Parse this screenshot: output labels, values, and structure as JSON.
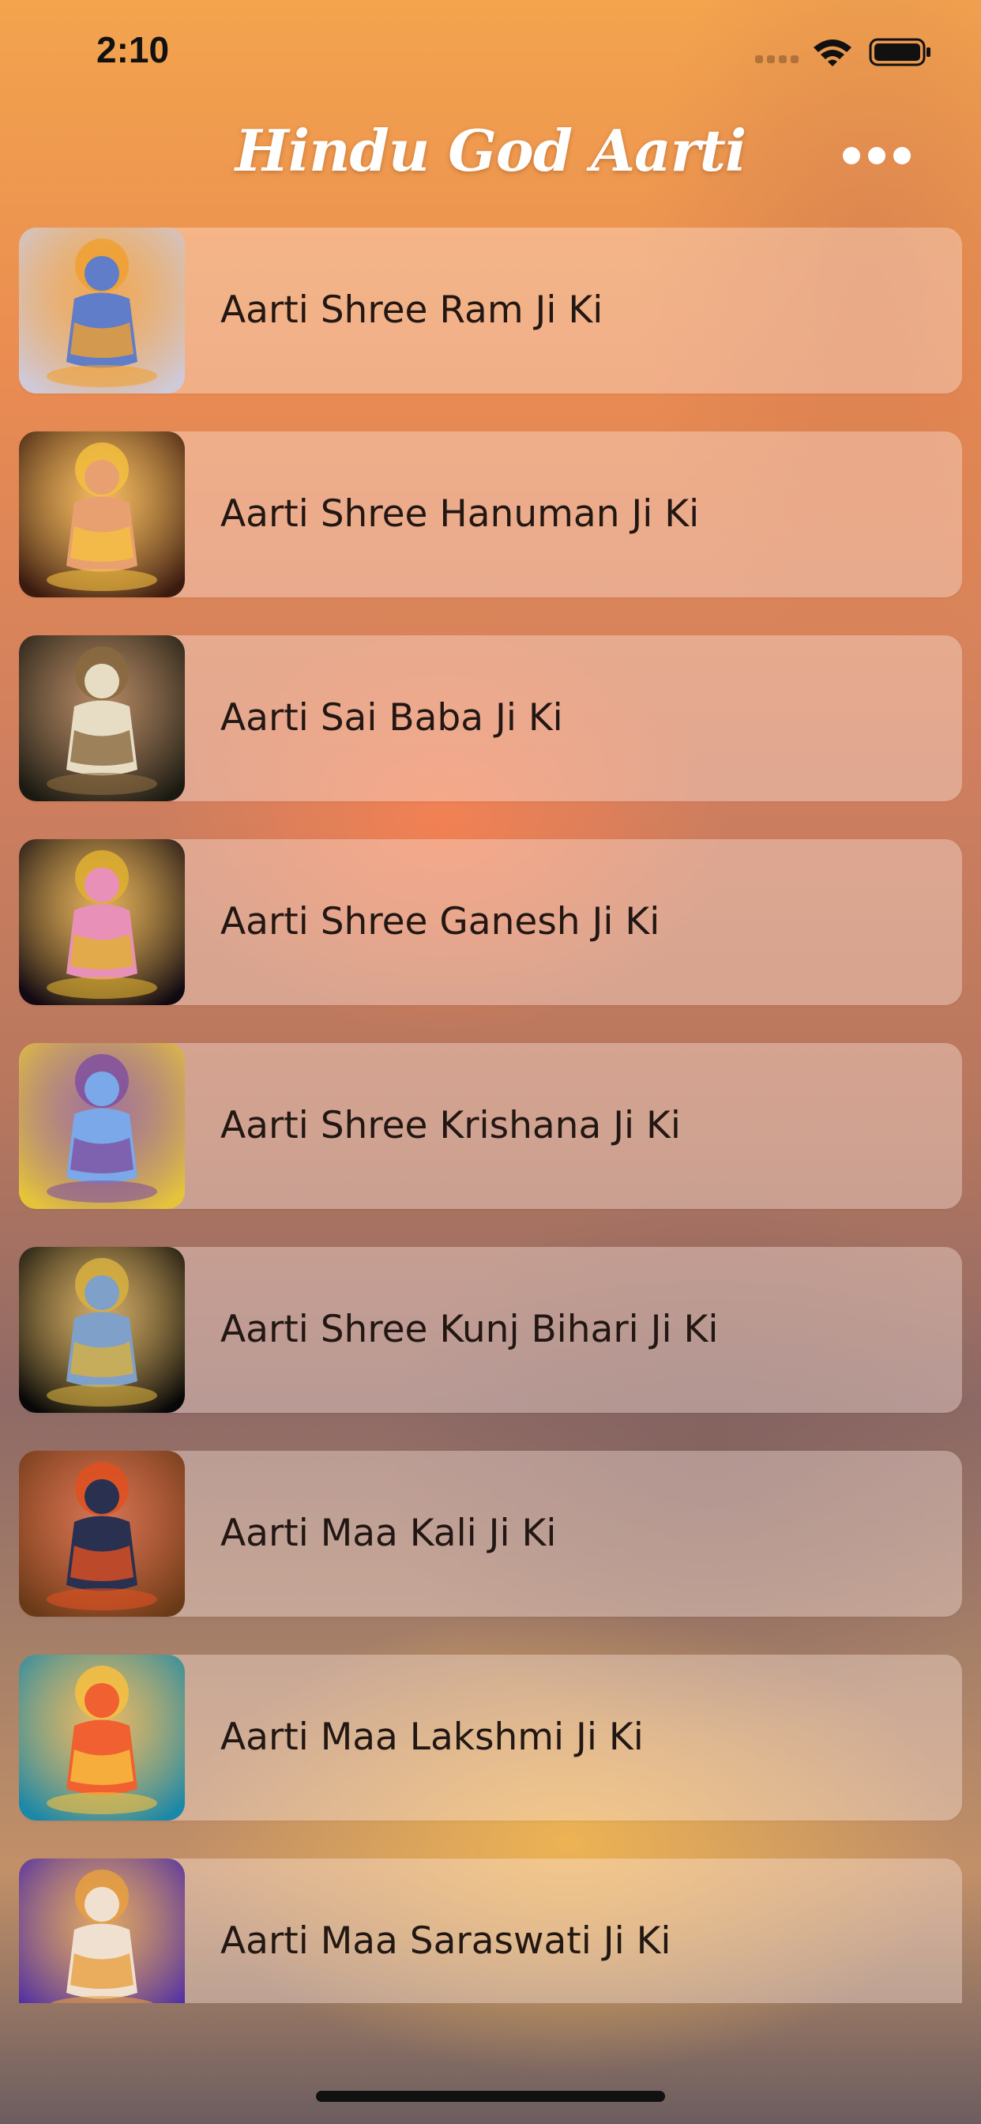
{
  "status_bar": {
    "time": "2:10"
  },
  "header": {
    "title": "Hindu God Aarti"
  },
  "list": {
    "items": [
      {
        "label": "Aarti Shree Ram Ji Ki",
        "thumb_bg": "#cfc9d8",
        "figure": "#5f7dc8",
        "accent": "#f0a030"
      },
      {
        "label": "Aarti Shree Hanuman Ji Ki",
        "thumb_bg": "#3b1a10",
        "figure": "#e8a070",
        "accent": "#f5c040"
      },
      {
        "label": "Aarti Sai Baba Ji Ki",
        "thumb_bg": "#1b1a12",
        "figure": "#e7dcc4",
        "accent": "#8a6a40"
      },
      {
        "label": "Aarti Shree Ganesh Ji Ki",
        "thumb_bg": "#120a12",
        "figure": "#e890b8",
        "accent": "#e0b030"
      },
      {
        "label": "Aarti Shree Krishana Ji Ki",
        "thumb_bg": "#e6c43a",
        "figure": "#7aa8e8",
        "accent": "#8050a0"
      },
      {
        "label": "Aarti Shree Kunj Bihari Ji Ki",
        "thumb_bg": "#080808",
        "figure": "#7fa0c8",
        "accent": "#d8b040"
      },
      {
        "label": "Aarti Maa Kali Ji Ki",
        "thumb_bg": "#6a3a18",
        "figure": "#2a3050",
        "accent": "#e05020"
      },
      {
        "label": "Aarti Maa Lakshmi Ji Ki",
        "thumb_bg": "#1a88a8",
        "figure": "#f06030",
        "accent": "#f8c040"
      },
      {
        "label": "Aarti Maa Saraswati Ji Ki",
        "thumb_bg": "#4a2aa8",
        "figure": "#f0e0d0",
        "accent": "#e8a040"
      }
    ]
  }
}
